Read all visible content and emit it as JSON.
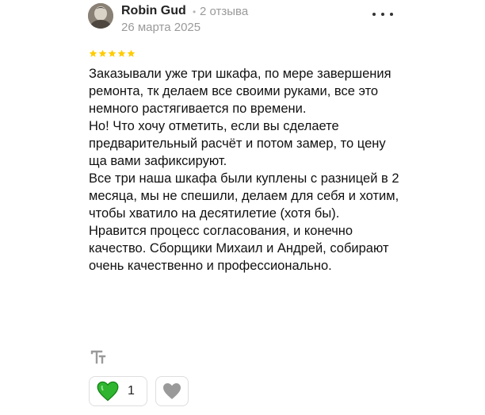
{
  "review": {
    "author": "Robin Gud",
    "separator": "•",
    "author_reviews": "2 отзыва",
    "date": "26 марта 2025",
    "rating": 5,
    "star_color": "#ffcc00",
    "paragraphs": [
      "Заказывали уже три шкафа, по мере завершения ремонта, тк делаем все своими руками, все это немного растягивается по времени.",
      "Но! Что хочу отметить, если вы сделаете предварительный расчёт и потом замер, то цену ща вами зафиксируют.",
      "Все три наша шкафа были куплены с разницей в 2 месяца, мы не спешили, делаем для себя и хотим, чтобы хватило на десятилетие (хотя бы).",
      "Нравится процесс согласования, и конечно качество. Сборщики Михаил и Андрей, собирают очень качественно и профессионально."
    ]
  },
  "reactions": {
    "like_count": "1",
    "like_icon": "green-heart-icon",
    "like_color": "#2fb52f",
    "dislike_icon": "gray-heart-icon",
    "dislike_color": "#9a9a9a"
  },
  "icons": {
    "translate": "translate-icon",
    "more": "more-dots-icon"
  }
}
